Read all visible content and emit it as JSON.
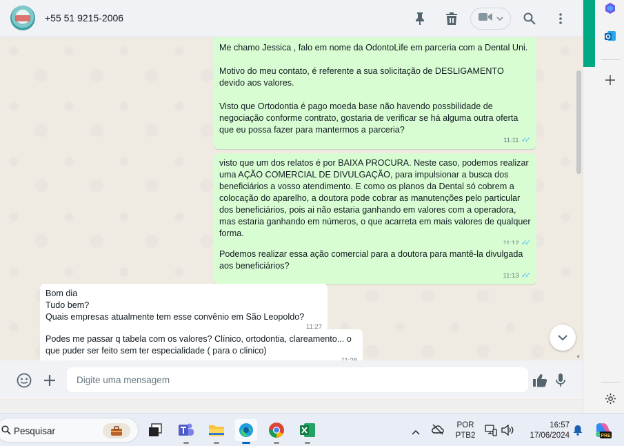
{
  "header": {
    "contact_name": "+55 51 9215-2006",
    "icons": [
      "pin-icon",
      "trash-icon",
      "video-call-icon",
      "chevron-down-icon",
      "search-icon",
      "more-vertical-icon"
    ]
  },
  "messages": [
    {
      "direction": "out",
      "text": "Me chamo Jessica , falo em nome da OdontoLife em parceria com a Dental Uni.\n\nMotivo do meu contato, é referente a sua solicitação de DESLIGAMENTO devido aos valores.\n\nVisto que Ortodontia é pago moeda base não havendo possbilidade de negociação conforme contrato, gostaria de verificar se há alguma outra oferta que eu possa fazer para mantermos a parceria?",
      "time": "11:11"
    },
    {
      "direction": "out",
      "text": "visto que um dos relatos é por BAIXA PROCURA. Neste caso, podemos realizar uma AÇÃO COMERCIAL DE DIVULGAÇÃO, para impulsionar a busca dos beneficiários a vosso atendimento. E como os planos da Dental só cobrem a colocação do aparelho, a doutora pode cobrar as manutenções pelo particular dos beneficiários, pois ai não estaria ganhando em valores com a operadora, mas estaria ganhando em números, o que acarreta em mais valores de qualquer forma.",
      "time": "11:12"
    },
    {
      "direction": "out",
      "text": "Podemos realizar essa ação comercial para a doutora para mantê-la divulgada aos beneficiários?",
      "time": "11:13"
    },
    {
      "direction": "in",
      "text": "Bom dia\nTudo bem?\nQuais empresas atualmente tem esse convênio em São Leopoldo?",
      "time": "11:27"
    },
    {
      "direction": "in",
      "text": "Podes me passar q tabela com os valores? Clínico, ortodontia, clareamento... o que puder ser feito sem ter especialidade ( para o clinico)",
      "time": "11:28"
    }
  ],
  "composer": {
    "placeholder": "Digite uma mensagem"
  },
  "taskbar": {
    "search_label": "Pesquisar",
    "language_top": "POR",
    "language_bottom": "PTB2",
    "time": "16:57",
    "date": "17/06/2024"
  },
  "colors": {
    "accent": "#00a884",
    "outgoing_bubble": "#d9fdd3",
    "incoming_bubble": "#ffffff",
    "read_ticks": "#53bdeb"
  }
}
